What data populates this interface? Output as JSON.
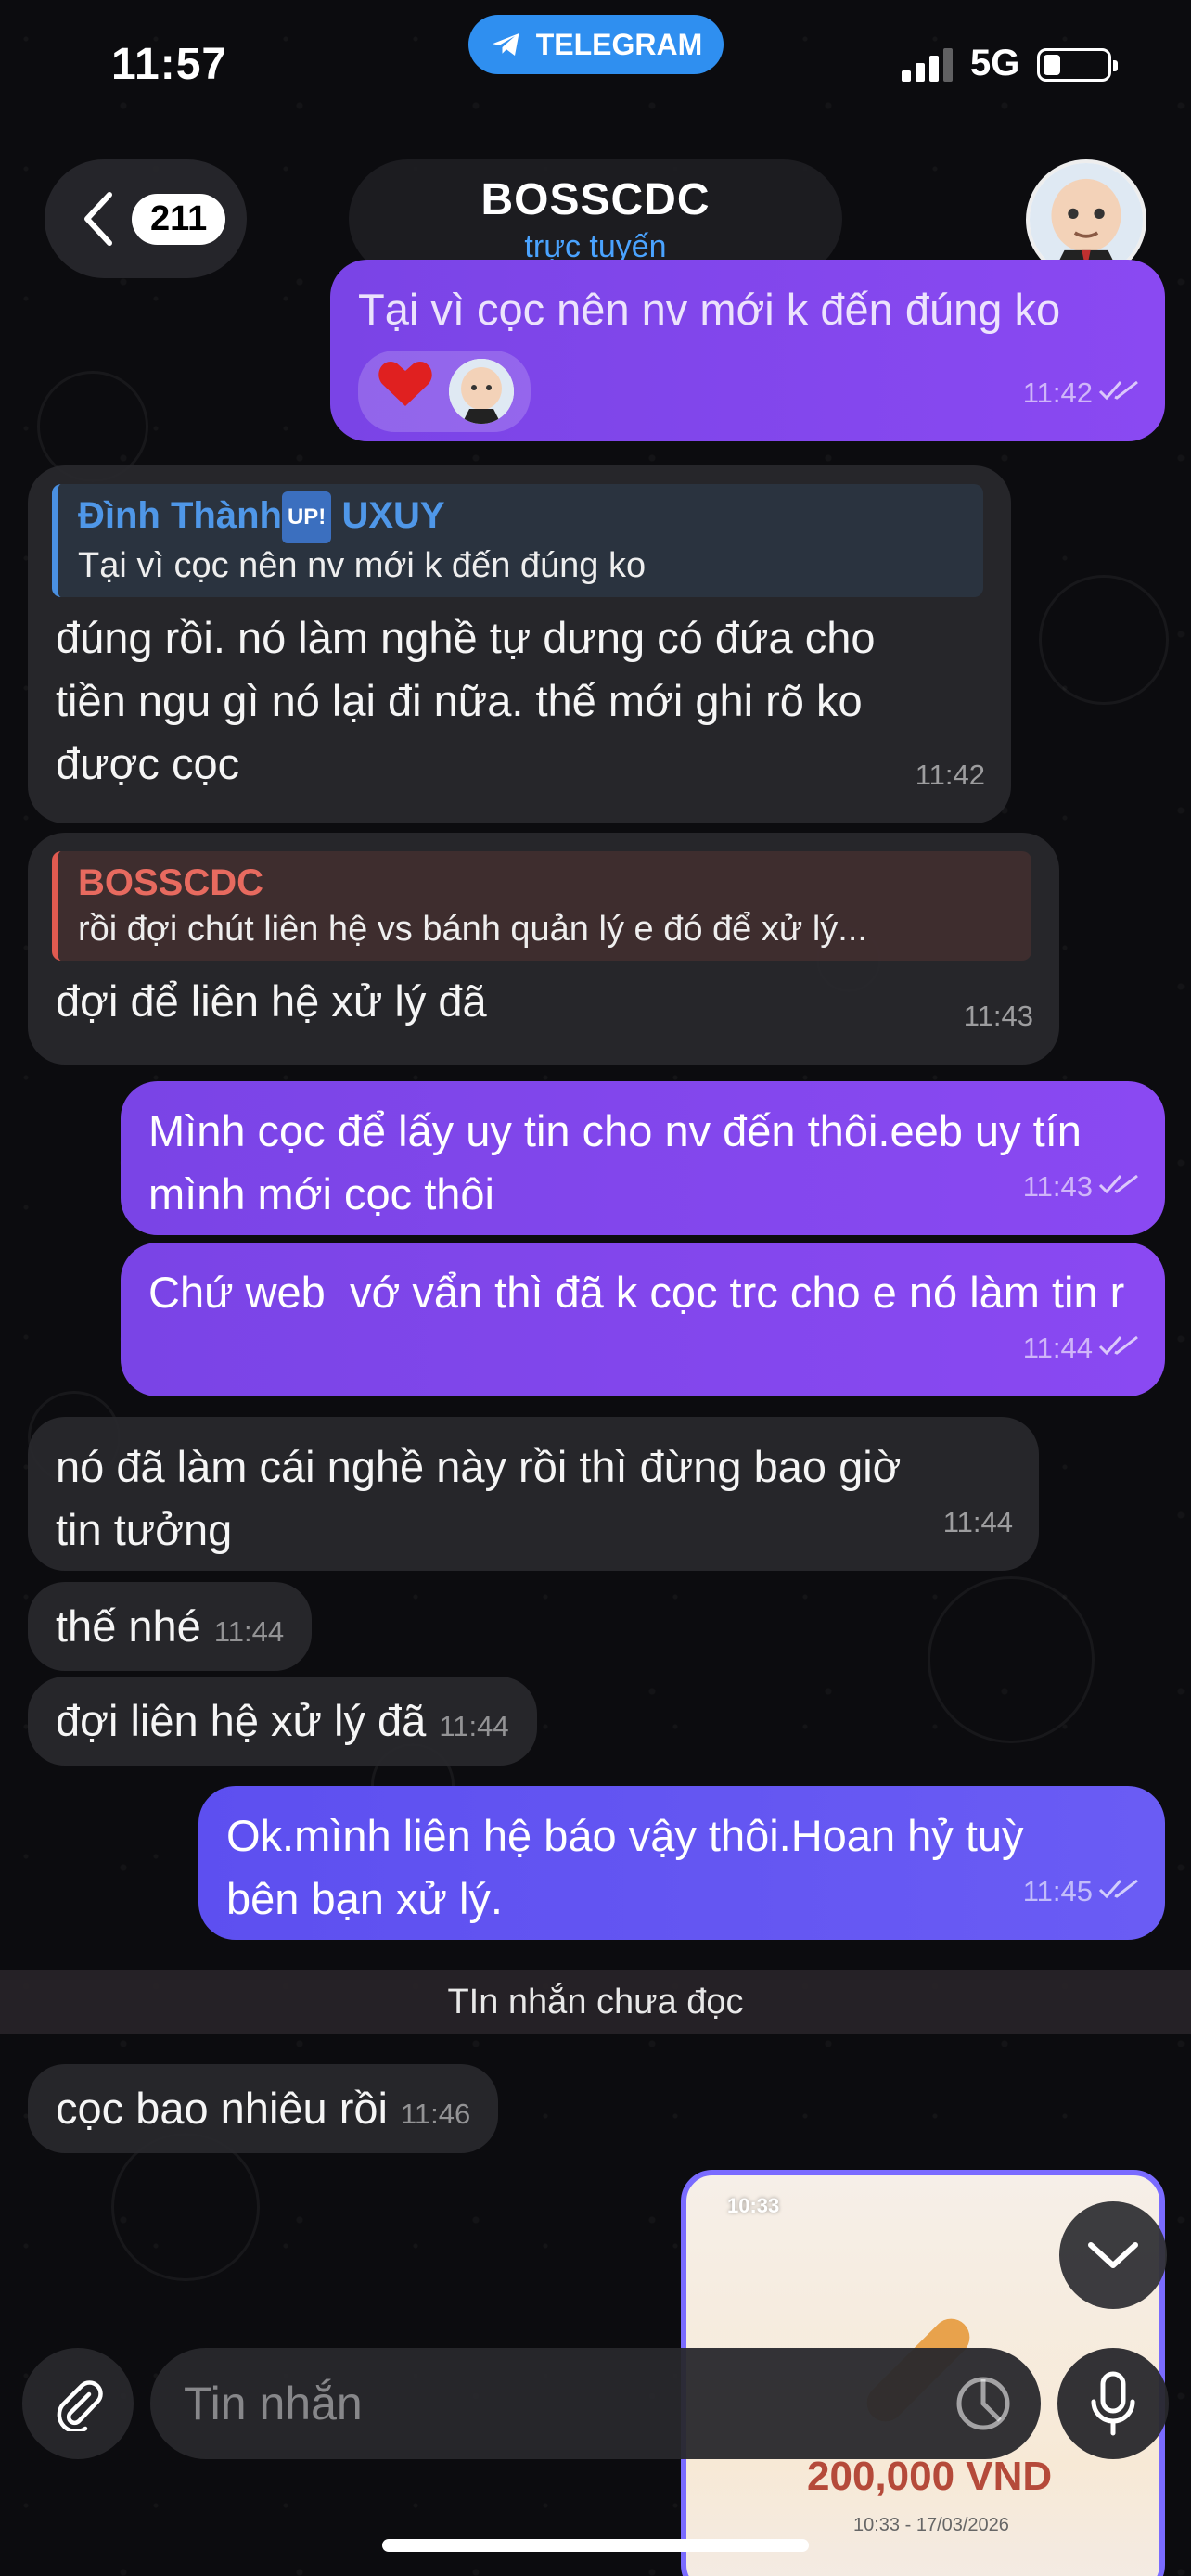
{
  "status_bar": {
    "time": "11:57",
    "app_pill": "TELEGRAM",
    "network": "5G"
  },
  "header": {
    "back_count": "211",
    "title": "BOSSCDC",
    "subtitle": "trực tuyến"
  },
  "messages": [
    {
      "dir": "out",
      "text": "Tại vì cọc nên nv mới k đến đúng ko",
      "time": "11:42",
      "reaction": "❤️"
    },
    {
      "dir": "in",
      "reply_name": "Đình Thành",
      "reply_badge": "UP!",
      "reply_suffix": "UXUY",
      "reply_text": "Tại vì cọc nên nv mới k đến đúng ko",
      "text": "đúng rồi. nó làm nghề tự dưng có đứa cho tiền ngu gì nó lại đi nữa. thế mới ghi rõ ko được cọc",
      "time": "11:42"
    },
    {
      "dir": "in",
      "reply_name": "BOSSCDC",
      "reply_text": "rồi đợi chút liên hệ vs bánh quản lý e đó để xử lý...",
      "text": "đợi để liên hệ xử lý đã",
      "time": "11:43"
    },
    {
      "dir": "out",
      "text": "Mình cọc để lấy uy tin cho nv đến thôi.eeb uy tín mình mới cọc thôi",
      "time": "11:43"
    },
    {
      "dir": "out",
      "text": "Chứ web  vớ vẩn thì đã k cọc trc cho e nó làm tin r",
      "time": "11:44"
    },
    {
      "dir": "in",
      "text": "nó đã làm cái nghề này rồi thì đừng bao giờ tin tưởng",
      "time": "11:44"
    },
    {
      "dir": "in",
      "text": "thế nhé",
      "time": "11:44"
    },
    {
      "dir": "in",
      "text": "đợi liên hệ xử lý đã",
      "time": "11:44"
    },
    {
      "dir": "out",
      "text": "Ok.mình liên hệ báo vậy thôi.Hoan hỷ tuỳ bên bạn xử lý.",
      "time": "11:45"
    },
    {
      "dir": "in",
      "text": "cọc bao nhiêu rồi",
      "time": "11:46"
    }
  ],
  "unread_divider": "TIn nhắn chưa đọc",
  "image_message": {
    "time": "10:33",
    "amount": "200,000 VND",
    "date": "10:33 - 17/03/2026"
  },
  "composer": {
    "placeholder": "Tin nhắn"
  },
  "colors": {
    "accent": "#2f8ff0",
    "outgoing": "#8a49f2",
    "incoming": "#28282c"
  }
}
